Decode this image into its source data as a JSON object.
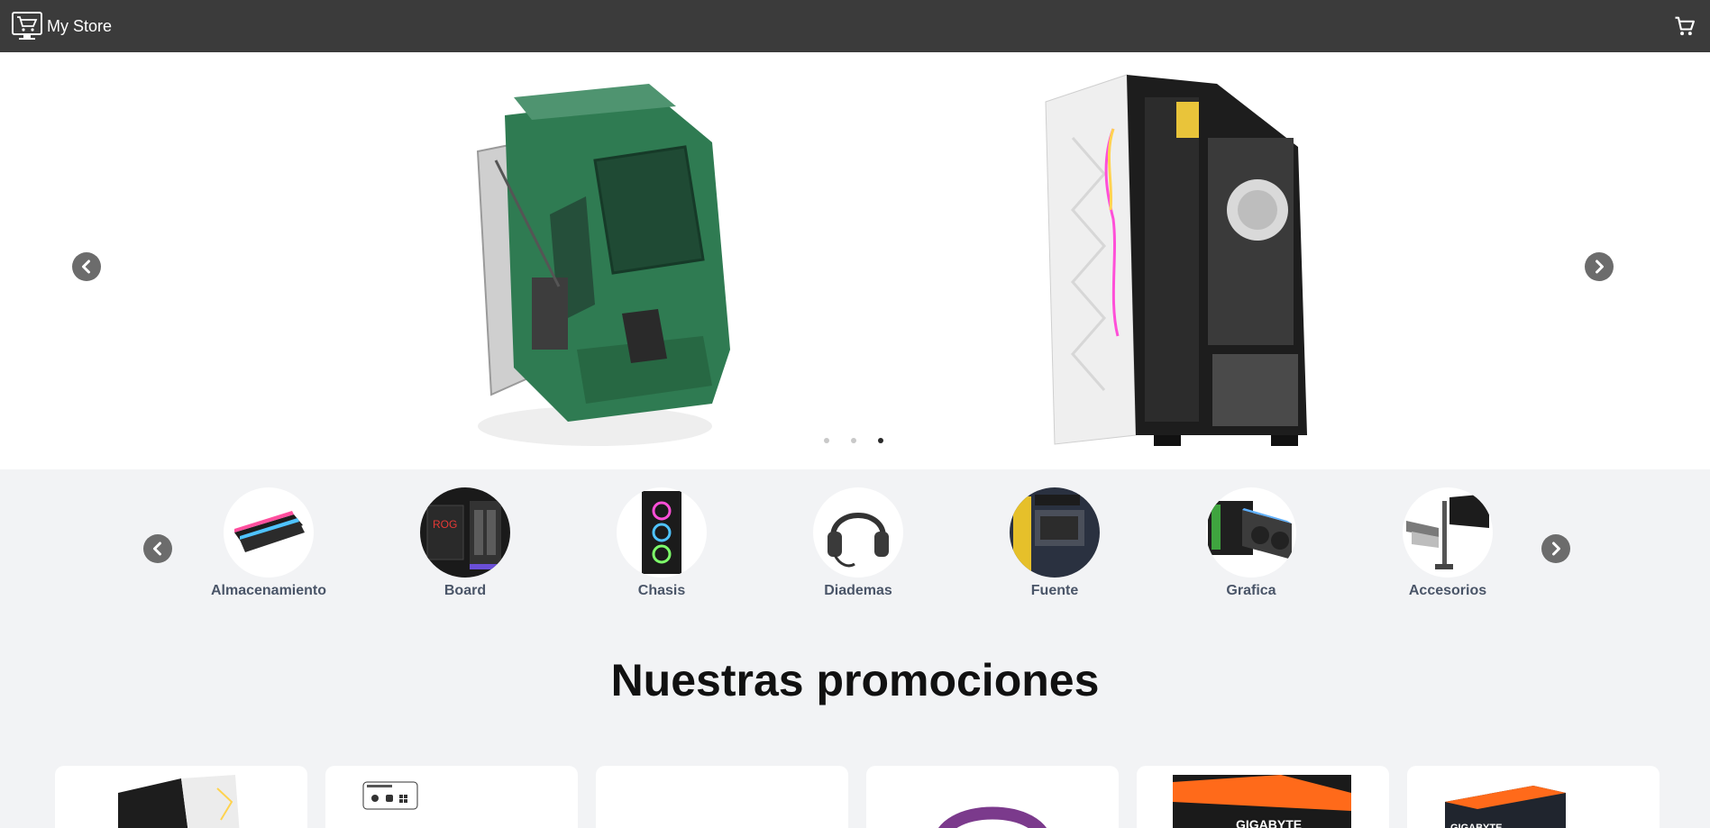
{
  "header": {
    "brand_name": "My Store",
    "brand_icon": "shopping-cart-monitor-icon",
    "cart_icon": "cart-icon"
  },
  "hero": {
    "slides_count": 3,
    "active_slide": 3,
    "prev_icon": "chevron-left-icon",
    "next_icon": "chevron-right-icon"
  },
  "categories": {
    "items": [
      {
        "label": "Almacenamiento",
        "icon": "ram-memory-icon"
      },
      {
        "label": "Board",
        "icon": "motherboard-icon"
      },
      {
        "label": "Chasis",
        "icon": "pc-case-icon"
      },
      {
        "label": "Diademas",
        "icon": "headset-icon"
      },
      {
        "label": "Fuente",
        "icon": "power-supply-icon"
      },
      {
        "label": "Grafica",
        "icon": "graphics-card-icon"
      },
      {
        "label": "Accesorios",
        "icon": "monitor-arm-icon"
      }
    ]
  },
  "promotions": {
    "title": "Nuestras promociones",
    "cards": [
      {
        "icon": "pc-case-icon"
      },
      {
        "icon": "platform-badge-icon"
      },
      {
        "icon": "motherboard-icon"
      },
      {
        "icon": "headset-icon"
      },
      {
        "icon": "graphics-card-box-icon"
      },
      {
        "icon": "graphics-card-box-icon"
      }
    ]
  },
  "colors": {
    "navbar": "#3b3b3b",
    "page_bg": "#f2f3f5",
    "category_label": "#4a5568",
    "arrow_bg": "#6c6c6c"
  }
}
